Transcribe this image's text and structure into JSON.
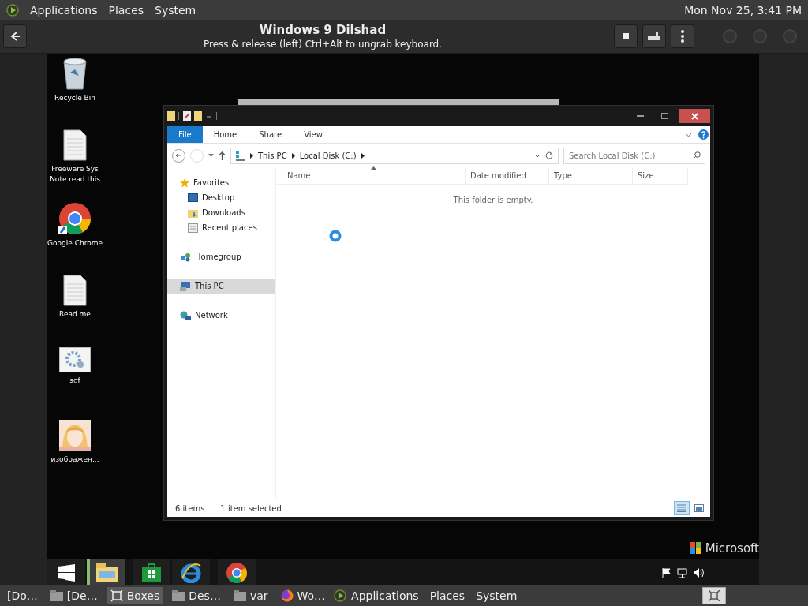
{
  "top_panel": {
    "menus": [
      "Applications",
      "Places",
      "System"
    ],
    "clock": "Mon Nov 25,  3:41 PM"
  },
  "boxes_header": {
    "title": "Windows 9  Dilshad",
    "subtitle": "Press & release (left) Ctrl+Alt to ungrab keyboard."
  },
  "desktop_icons": [
    {
      "label": "Recycle Bin",
      "kind": "bin"
    },
    {
      "label": "Freeware Sys Note read this",
      "kind": "document"
    },
    {
      "label": "Google Chrome",
      "kind": "chrome"
    },
    {
      "label": "Read me",
      "kind": "document"
    },
    {
      "label": "sdf",
      "kind": "settings"
    },
    {
      "label": "изображен...",
      "kind": "picture"
    }
  ],
  "explorer": {
    "ribbon_tabs": [
      {
        "label": "File",
        "selected": true
      },
      {
        "label": "Home",
        "selected": false
      },
      {
        "label": "Share",
        "selected": false
      },
      {
        "label": "View",
        "selected": false
      }
    ],
    "breadcrumb": [
      "This PC",
      "Local Disk (C:)"
    ],
    "search": {
      "placeholder": "Search Local Disk (C:)"
    },
    "nav": [
      {
        "label": "Favorites",
        "kind": "star",
        "selected": false,
        "children": [
          {
            "label": "Desktop",
            "kind": "desktop",
            "selected": false
          },
          {
            "label": "Downloads",
            "kind": "downloads",
            "selected": false
          },
          {
            "label": "Recent places",
            "kind": "recent",
            "selected": false
          }
        ]
      },
      {
        "label": "Homegroup",
        "kind": "homegroup",
        "selected": false
      },
      {
        "label": "This PC",
        "kind": "pc",
        "selected": true
      },
      {
        "label": "Network",
        "kind": "network",
        "selected": false
      }
    ],
    "columns": [
      "Name",
      "Date modified",
      "Type",
      "Size"
    ],
    "empty_message": "This folder is empty.",
    "status": [
      "6 items",
      "1 item selected"
    ],
    "views": [
      {
        "kind": "details",
        "selected": true
      },
      {
        "kind": "tiles",
        "selected": false
      }
    ]
  },
  "win_taskbar": {
    "branding": "Microsoft",
    "items": [
      {
        "kind": "start",
        "selected": false
      },
      {
        "kind": "explorer",
        "selected": true
      },
      {
        "kind": "store",
        "selected": false
      },
      {
        "kind": "ie",
        "selected": false
      },
      {
        "kind": "chrome",
        "selected": false
      }
    ]
  },
  "bottom_panel": {
    "tasks": [
      {
        "label": "[Do…",
        "kind": "none",
        "selected": false
      },
      {
        "label": "[De…",
        "kind": "folder",
        "selected": false
      },
      {
        "label": "Boxes",
        "kind": "boxes",
        "selected": true
      },
      {
        "label": "Des…",
        "kind": "folder",
        "selected": false
      },
      {
        "label": "var",
        "kind": "folder",
        "selected": false
      },
      {
        "label": "Wo…",
        "kind": "firefox",
        "selected": false
      }
    ],
    "menus": [
      "Applications",
      "Places",
      "System"
    ]
  }
}
